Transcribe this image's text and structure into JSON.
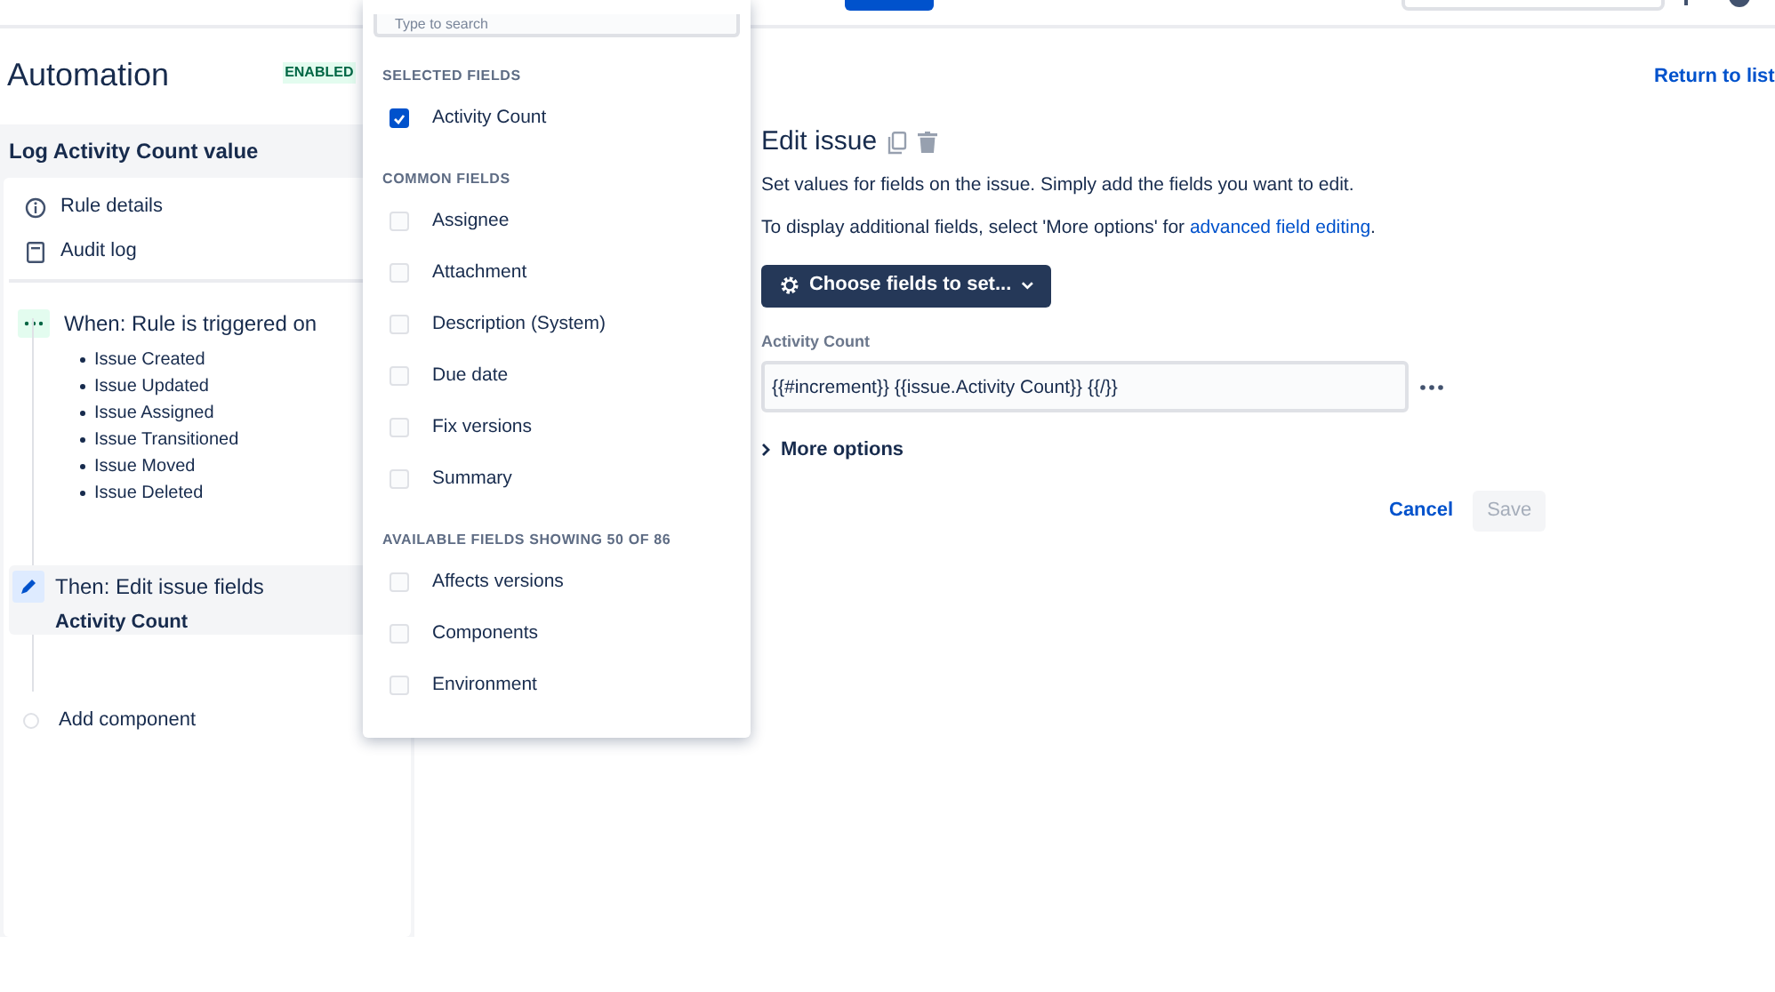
{
  "page": {
    "title": "Automation",
    "badge": "ENABLED",
    "return_link": "Return to list"
  },
  "rule": {
    "name": "Log Activity Count value",
    "nav": [
      {
        "kind": "info",
        "label": "Rule details"
      },
      {
        "kind": "log",
        "label": "Audit log"
      }
    ],
    "trigger": {
      "label": "When: Rule is triggered on",
      "events": [
        "Issue Created",
        "Issue Updated",
        "Issue Assigned",
        "Issue Transitioned",
        "Issue Moved",
        "Issue Deleted"
      ]
    },
    "action": {
      "label": "Then: Edit issue fields",
      "detail": "Activity Count"
    },
    "add": "Add component"
  },
  "field_picker": {
    "search_placeholder": "Type to search",
    "sections": [
      {
        "heading": "SELECTED FIELDS",
        "items": [
          {
            "label": "Activity Count",
            "checked": true
          }
        ]
      },
      {
        "heading": "COMMON FIELDS",
        "items": [
          {
            "label": "Assignee",
            "checked": false
          },
          {
            "label": "Attachment",
            "checked": false
          },
          {
            "label": "Description (System)",
            "checked": false
          },
          {
            "label": "Due date",
            "checked": false
          },
          {
            "label": "Fix versions",
            "checked": false
          },
          {
            "label": "Summary",
            "checked": false
          }
        ]
      },
      {
        "heading": "AVAILABLE FIELDS SHOWING 50 OF 86",
        "items": [
          {
            "label": "Affects versions",
            "checked": false
          },
          {
            "label": "Components",
            "checked": false
          },
          {
            "label": "Environment",
            "checked": false
          }
        ]
      }
    ]
  },
  "editor": {
    "title": "Edit issue",
    "description": "Set values for fields on the issue. Simply add the fields you want to edit.",
    "hint": "To display additional fields, select 'More options' for ",
    "hint_link": "advanced field editing",
    "hint_end": ".",
    "choose_button": "Choose fields to set...",
    "field_label": "Activity Count",
    "field_value": "{{#increment}} {{issue.Activity Count}} {{/}}",
    "more_options": "More options",
    "cancel": "Cancel",
    "save": "Save",
    "save_disabled": true
  }
}
